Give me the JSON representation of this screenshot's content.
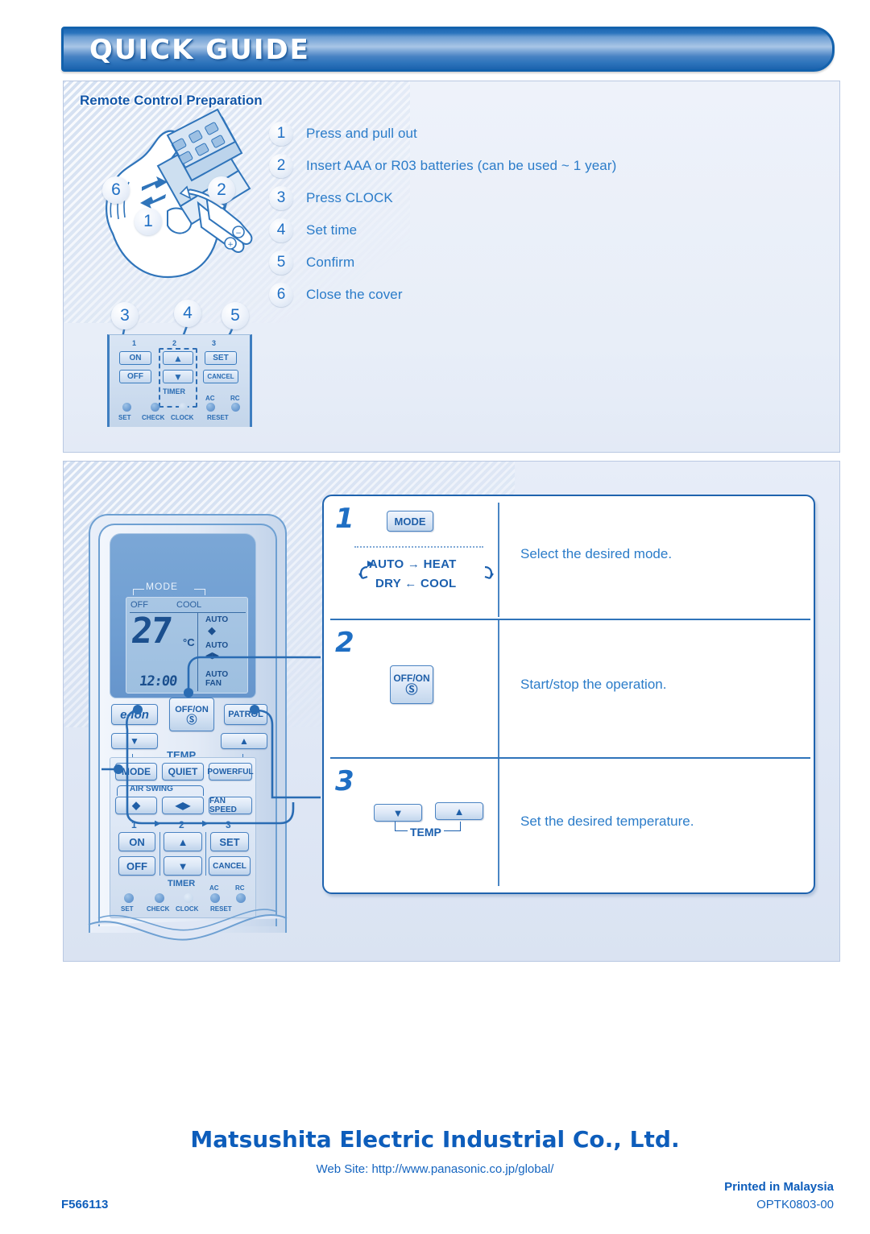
{
  "header": {
    "title": "QUICK GUIDE"
  },
  "top_section": {
    "title": "Remote Control Preparation",
    "steps": [
      {
        "num": "1",
        "text": "Press and pull out"
      },
      {
        "num": "2",
        "text": "Insert AAA or R03 batteries (can be used ~ 1 year)"
      },
      {
        "num": "3",
        "text": "Press CLOCK"
      },
      {
        "num": "4",
        "text": "Set time"
      },
      {
        "num": "5",
        "text": "Confirm"
      },
      {
        "num": "6",
        "text": "Close the cover"
      }
    ],
    "callouts": [
      "6",
      "2",
      "1",
      "3",
      "4",
      "5"
    ],
    "mini_remote": {
      "col_nums": [
        "1",
        "2",
        "3"
      ],
      "keys": [
        "ON",
        "OFF",
        "▲",
        "▼",
        "SET",
        "CANCEL"
      ],
      "timer_label": "TIMER",
      "indicator_labels": [
        "SET",
        "CHECK",
        "CLOCK"
      ],
      "reset_labels": [
        "AC",
        "RC"
      ],
      "reset_text": "RESET"
    }
  },
  "remote": {
    "lcd": {
      "mode_label": "MODE",
      "off_label": "OFF",
      "cool_label": "COOL",
      "temperature": "27",
      "unit": "°C",
      "clock": "12:00",
      "auto_swing_label": "AUTO",
      "auto_air_label": "AUTO",
      "auto_fan_label": "AUTO",
      "fan_label": "FAN"
    },
    "buttons": {
      "eion": "e-ion",
      "offon": "OFF/ON",
      "patrol": "PATROL",
      "temp_label": "TEMP",
      "temp_down": "▼",
      "temp_up": "▲",
      "mode": "MODE",
      "quiet": "QUIET",
      "powerful": "POWERFUL",
      "air_swing": "AIR SWING",
      "swing_vert": "◆",
      "swing_horiz": "◀▶",
      "fan_speed": "FAN SPEED",
      "timer_cols": [
        "1",
        "2",
        "3"
      ],
      "on": "ON",
      "off": "OFF",
      "up": "▲",
      "down": "▼",
      "set": "SET",
      "cancel": "CANCEL",
      "timer": "TIMER",
      "ind_set": "SET",
      "ind_check": "CHECK",
      "ind_clock": "CLOCK",
      "ind_ac": "AC",
      "ind_rc": "RC",
      "ind_reset": "RESET"
    }
  },
  "instructions": [
    {
      "num": "1",
      "key_label": "MODE",
      "cycle_top": "AUTO → HEAT",
      "cycle_bottom": "DRY ← COOL",
      "description": "Select the desired mode."
    },
    {
      "num": "2",
      "key_label": "OFF/ON",
      "key_symbol": "⏻",
      "description": "Start/stop the operation."
    },
    {
      "num": "3",
      "key_down": "▼",
      "key_up": "▲",
      "temp_label": "TEMP",
      "description": "Set the desired temperature."
    }
  ],
  "footer": {
    "company": "Matsushita Electric Industrial Co., Ltd.",
    "website": "Web Site: http://www.panasonic.co.jp/global/",
    "printed_in": "Printed in Malaysia",
    "doc_code": "OPTK0803-00",
    "form_number": "F566113"
  },
  "colors": {
    "brand_blue": "#1f63ae",
    "text_blue": "#2b7cc9",
    "header_dark": "#1362ad"
  }
}
